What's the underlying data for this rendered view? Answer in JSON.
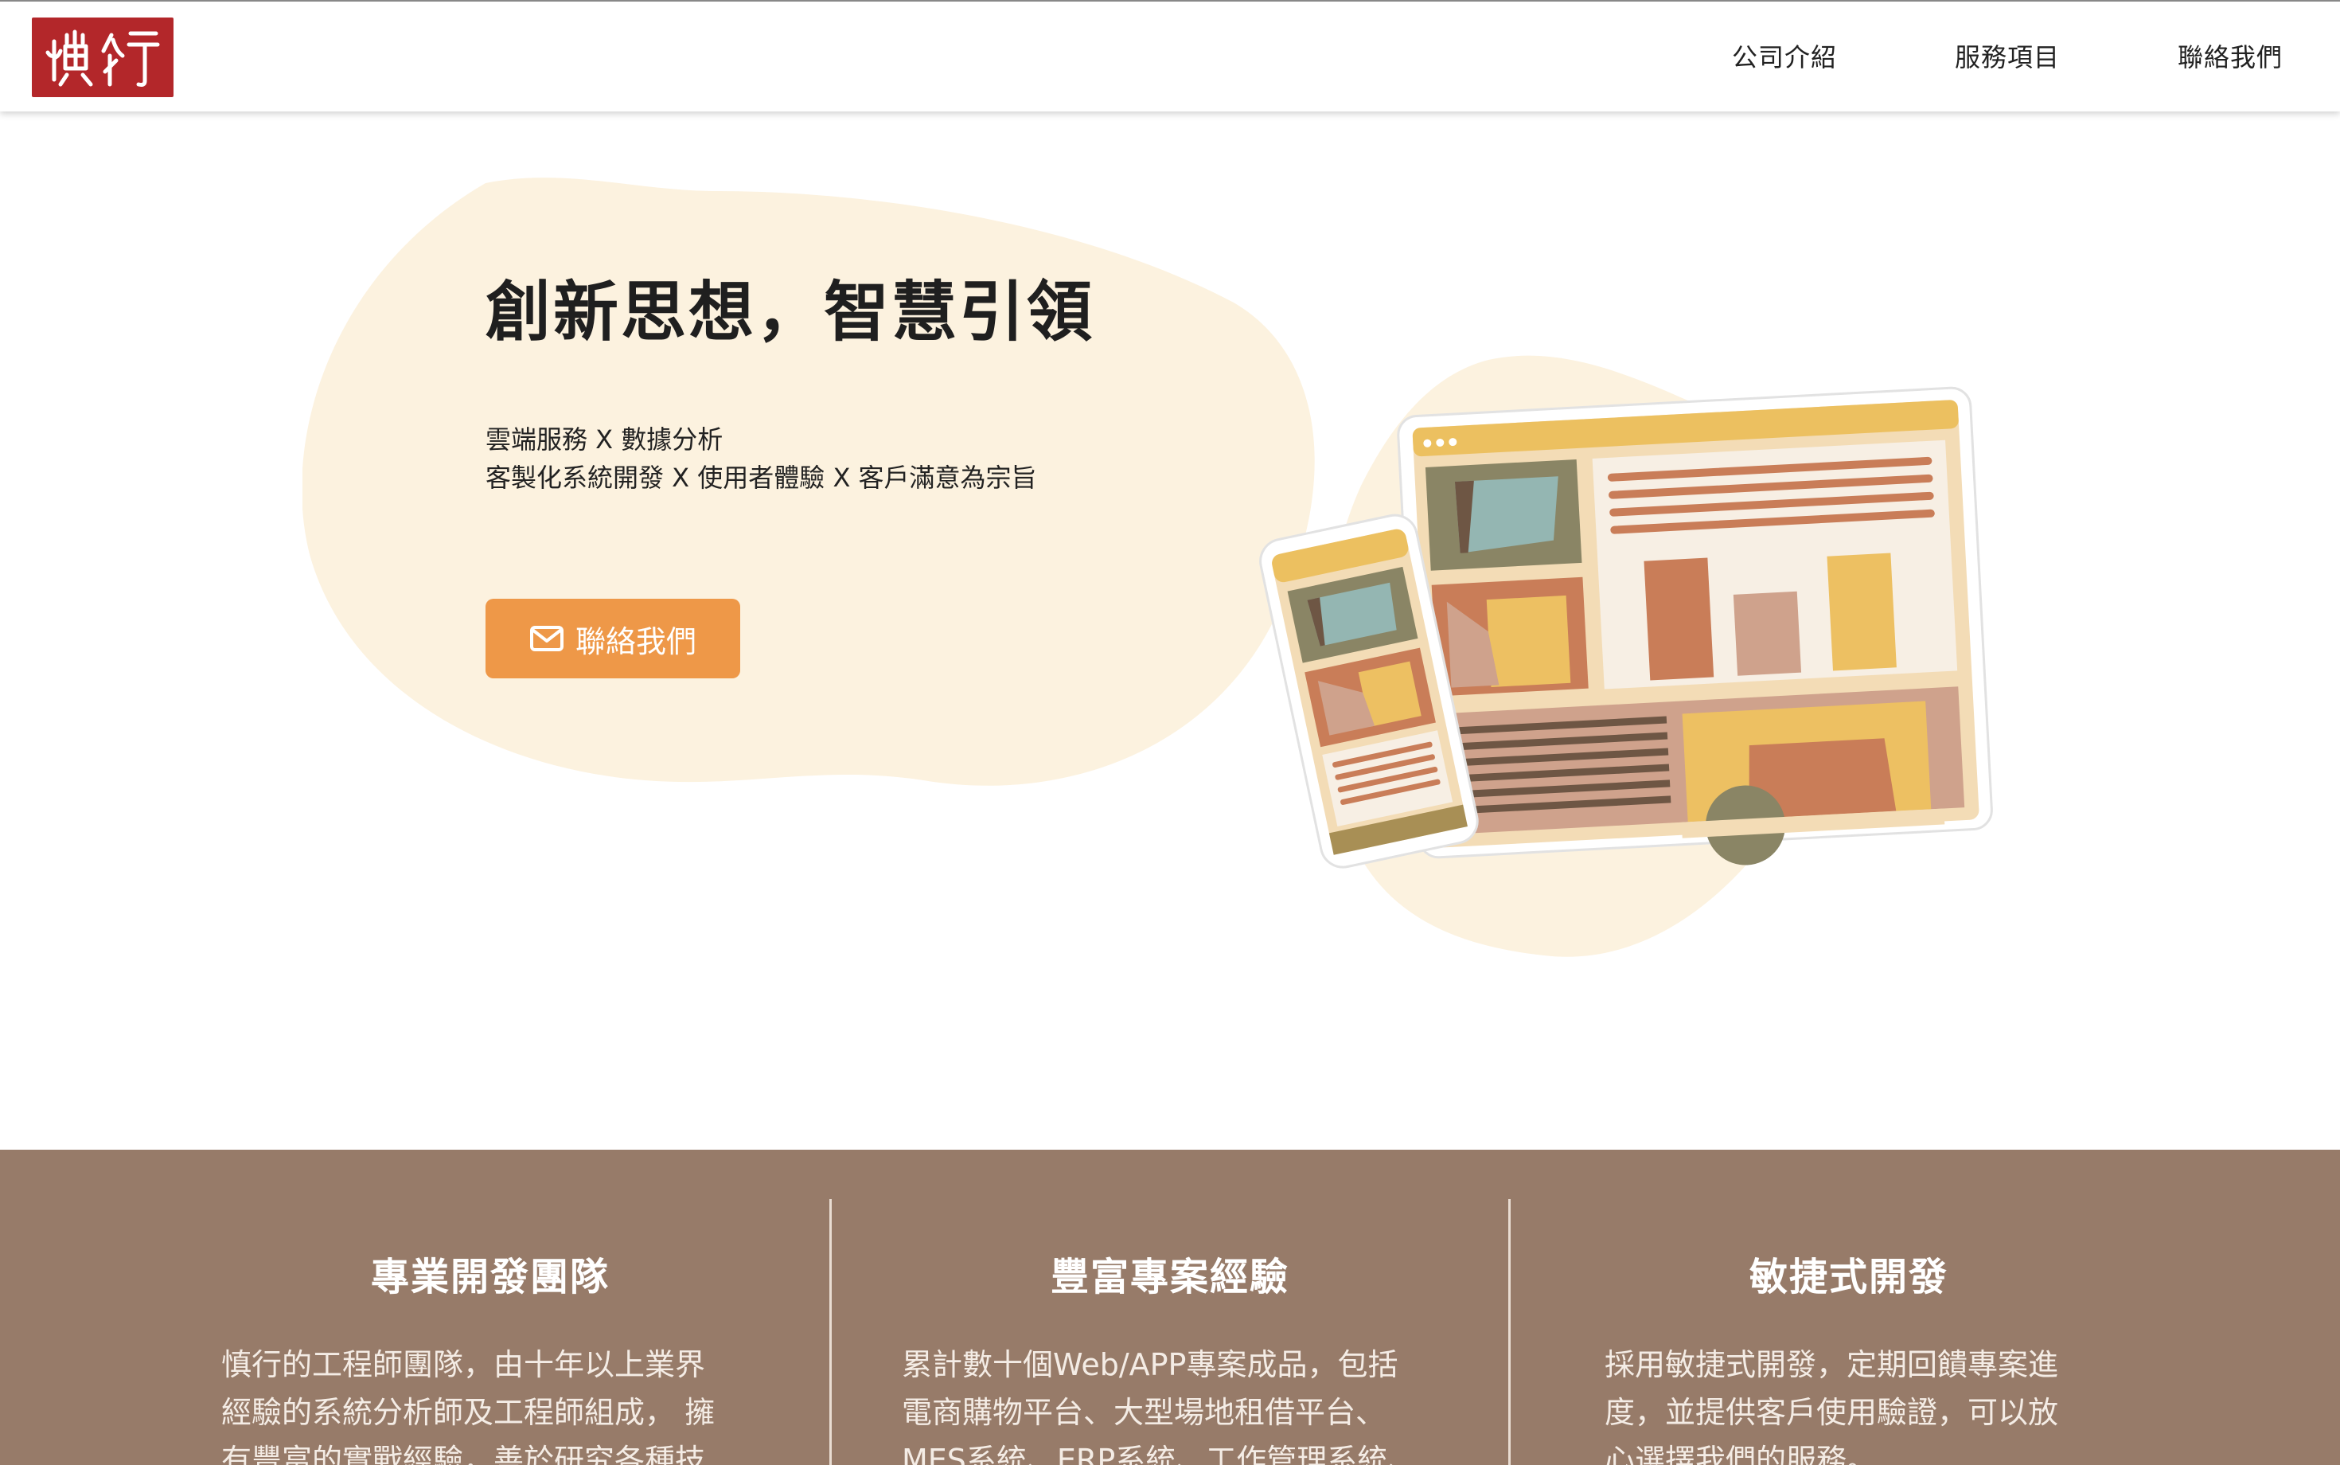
{
  "header": {
    "logo_text": "慎行",
    "nav": [
      "公司介紹",
      "服務項目",
      "聯絡我們"
    ]
  },
  "hero": {
    "title": "創新思想，智慧引領",
    "subtitle_line1": "雲端服務 X 數據分析",
    "subtitle_line2": "客製化系統開發 X 使用者體驗 X 客戶滿意為宗旨",
    "cta_label": "聯絡我們",
    "cta_icon": "envelope-icon"
  },
  "features": [
    {
      "title": "專業開發團隊",
      "lines": [
        "慎行的工程師團隊，由十年以上業界",
        "經驗的系統分析師及工程師組成， 擁",
        "有豐富的實戰經驗，善於研究各種技"
      ]
    },
    {
      "title": "豐富專案經驗",
      "lines": [
        "累計數十個Web/APP專案成品，包括",
        "電商購物平台、大型場地租借平台、",
        "MES系統、ERP系統、工作管理系統、"
      ]
    },
    {
      "title": "敏捷式開發",
      "lines": [
        "採用敏捷式開發，定期回饋專案進",
        "度，並提供客戶使用驗證，可以放",
        "心選擇我們的服務。"
      ]
    }
  ],
  "colors": {
    "brand_red": "#b3272a",
    "cta_orange": "#ee9848",
    "band_brown": "#977b69",
    "blob_cream": "#fcf2df"
  }
}
